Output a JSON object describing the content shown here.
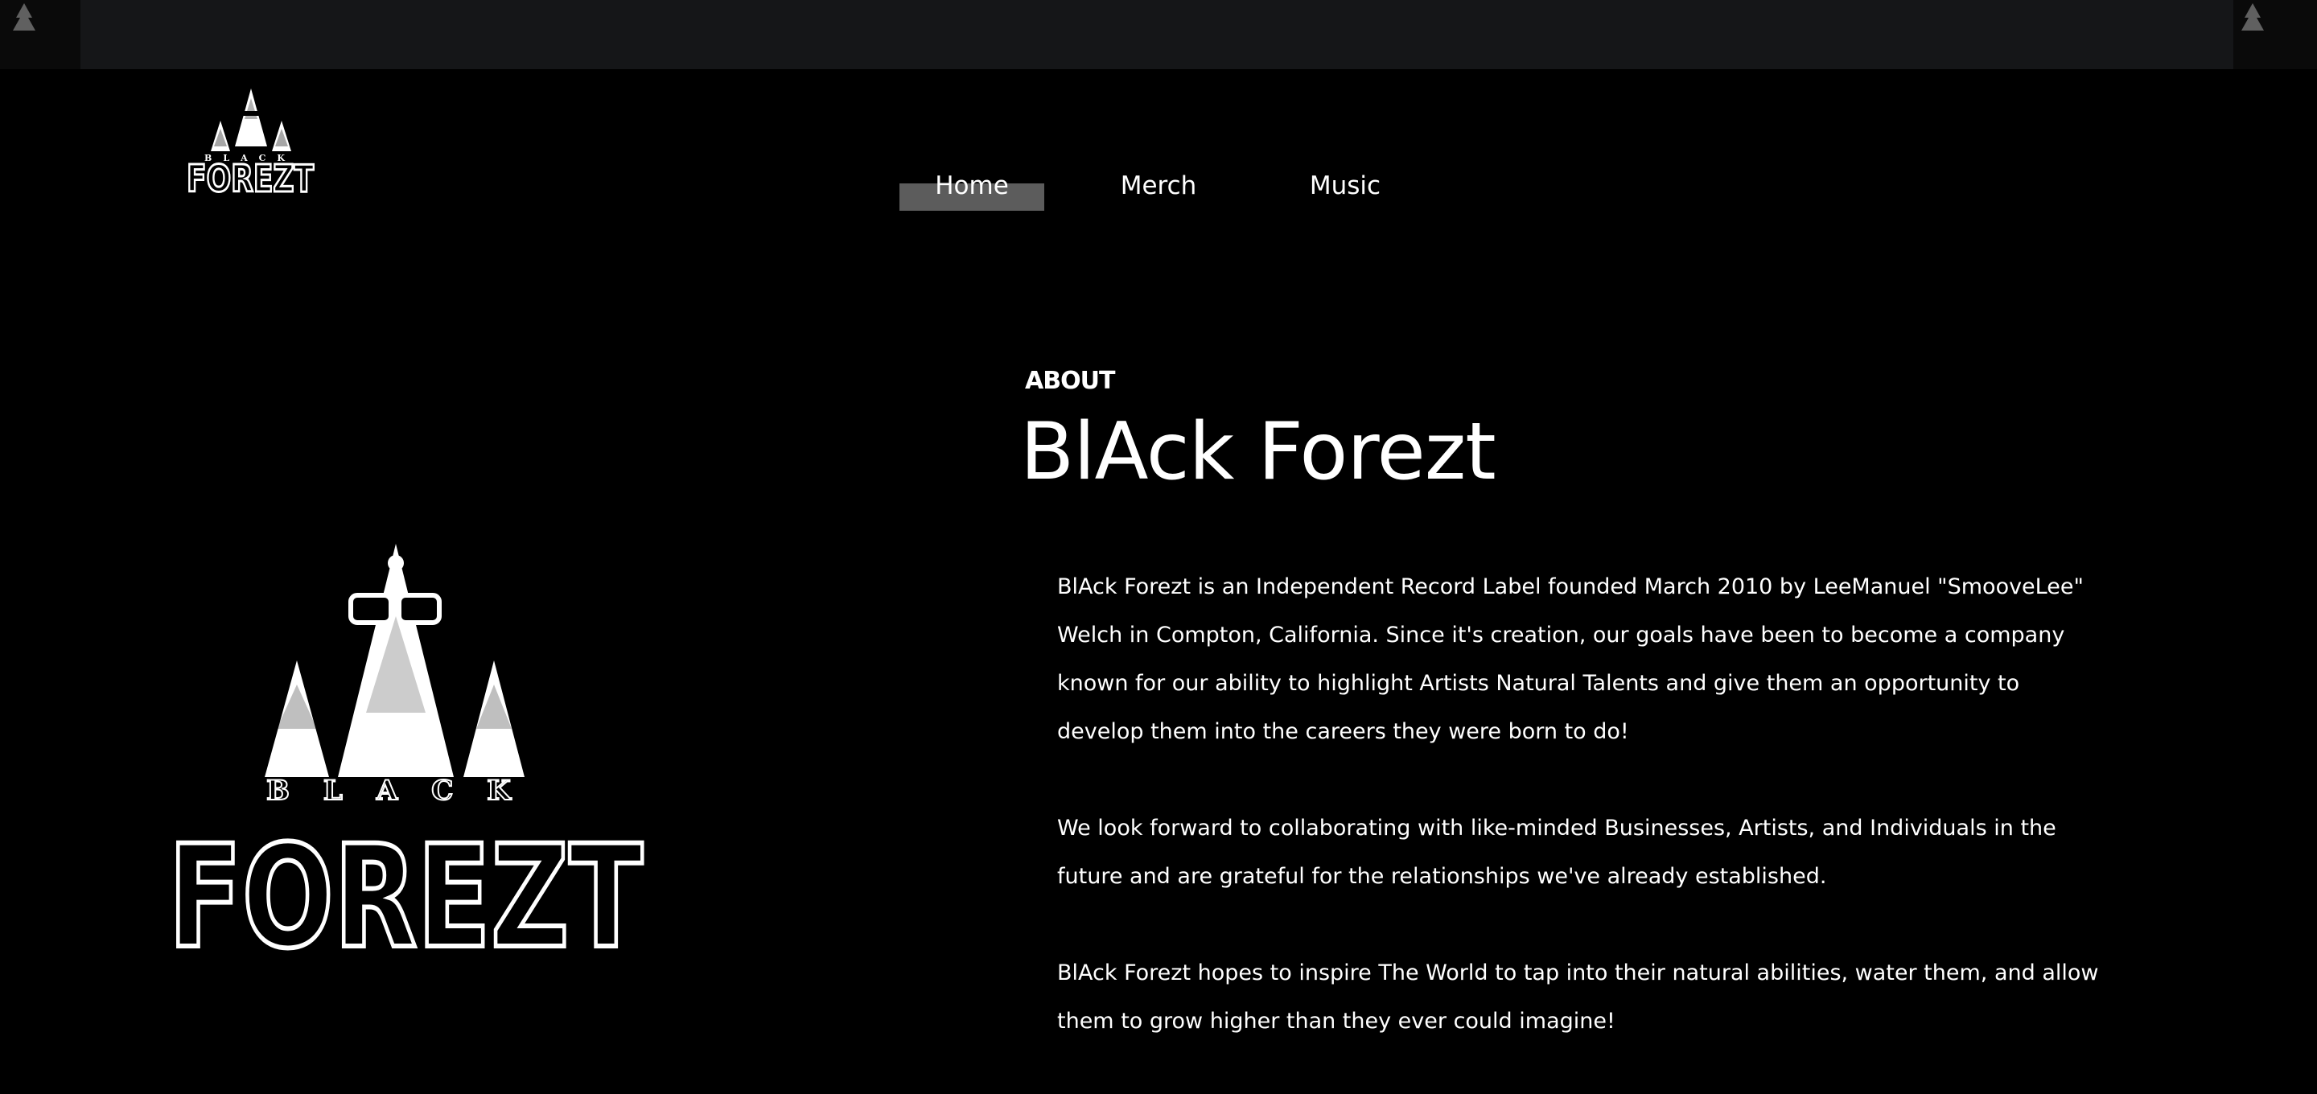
{
  "nav": {
    "items": [
      {
        "label": "Home",
        "active": true
      },
      {
        "label": "Merch",
        "active": false
      },
      {
        "label": "Music",
        "active": false
      }
    ]
  },
  "logo": {
    "wordmark_top": "BLACK",
    "wordmark_main": "FOREZT"
  },
  "about": {
    "kicker": "ABOUT",
    "title": "BlAck Forezt",
    "paragraphs": [
      "BlAck Forezt is an Independent Record Label founded March 2010 by LeeManuel \"SmooveLee\" Welch in Compton, California. Since it's creation, our goals have been to become a company known for our ability to highlight Artists Natural Talents and give them an opportunity to develop them into the careers they were born to do!",
      "We look forward to collaborating with like-minded Businesses, Artists, and Individuals in the future and are grateful for the relationships we've already established.",
      "BlAck Forezt hopes to inspire The World to tap into their natural abilities, water them, and allow them to grow higher than they ever could imagine!"
    ]
  },
  "colors": {
    "background": "#000000",
    "text": "#ffffff",
    "nav_highlight": "#5c5c5c",
    "top_strip": "#151618"
  }
}
